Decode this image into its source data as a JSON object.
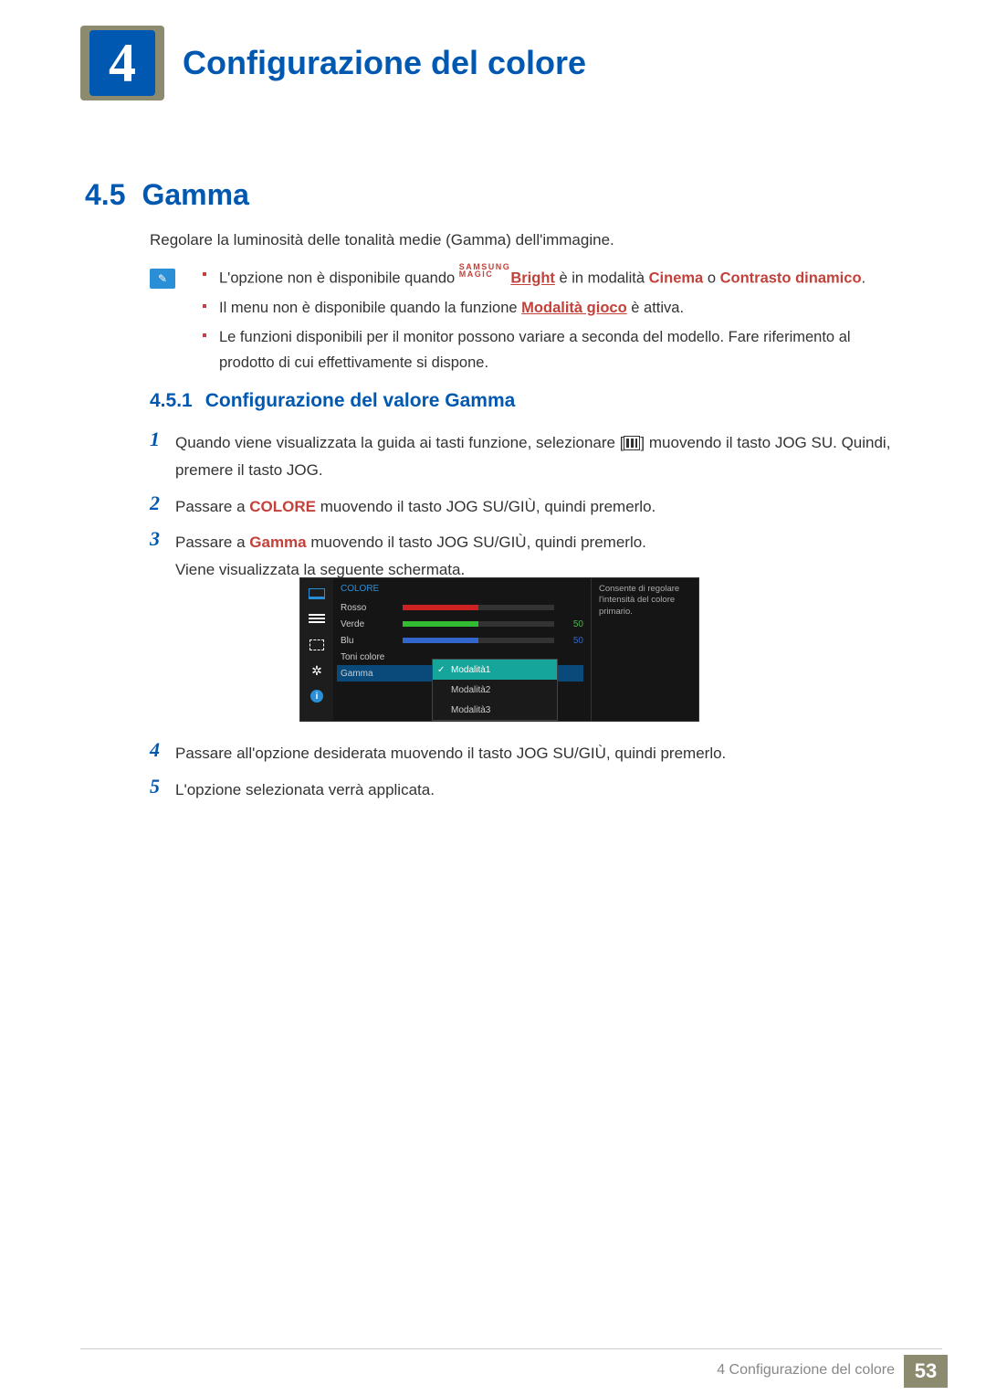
{
  "chapter": {
    "number": "4",
    "title": "Configurazione del colore"
  },
  "section": {
    "number": "4.5",
    "title": "Gamma"
  },
  "intro": "Regolare la luminosità delle tonalità medie (Gamma) dell'immagine.",
  "notes": {
    "n1a": "L'opzione non è disponibile quando ",
    "n1_magic_top": "SAMSUNG",
    "n1_magic_bot": "MAGIC",
    "n1_bright": "Bright",
    "n1b": " è in modalità ",
    "n1_cinema": "Cinema",
    "n1c": " o ",
    "n1_contrasto": "Contrasto dinamico",
    "n1d": ".",
    "n2a": "Il menu non è disponibile quando la funzione ",
    "n2_modegame": "Modalità gioco",
    "n2b": " è attiva.",
    "n3": "Le funzioni disponibili per il monitor possono variare a seconda del modello. Fare riferimento al prodotto di cui effettivamente si dispone."
  },
  "subsection": {
    "number": "4.5.1",
    "title": "Configurazione del valore Gamma"
  },
  "steps": {
    "s1_num": "1",
    "s1a": "Quando viene visualizzata la guida ai tasti funzione, selezionare [",
    "s1b": "] muovendo il tasto JOG SU. Quindi, premere il tasto JOG.",
    "s2_num": "2",
    "s2a": "Passare a ",
    "s2_colore": "COLORE",
    "s2b": " muovendo il tasto JOG SU/GIÙ, quindi premerlo.",
    "s3_num": "3",
    "s3a": "Passare a ",
    "s3_gamma": "Gamma",
    "s3b": " muovendo il tasto JOG SU/GIÙ, quindi premerlo.",
    "s3c": "Viene visualizzata la seguente schermata.",
    "s4_num": "4",
    "s4": "Passare all'opzione desiderata muovendo il tasto JOG SU/GIÙ, quindi premerlo.",
    "s5_num": "5",
    "s5": "L'opzione selezionata verrà applicata."
  },
  "osd": {
    "title": "COLORE",
    "rows": {
      "rosso": "Rosso",
      "verde": "Verde",
      "blu": "Blu",
      "toni": "Toni colore",
      "gamma": "Gamma"
    },
    "val_verde": "50",
    "val_blu": "50",
    "dropdown": {
      "m1": "Modalità1",
      "m2": "Modalità2",
      "m3": "Modalità3"
    },
    "tooltip": "Consente di regolare l'intensità del colore primario."
  },
  "footer": {
    "text": "4 Configurazione del colore",
    "page": "53"
  }
}
